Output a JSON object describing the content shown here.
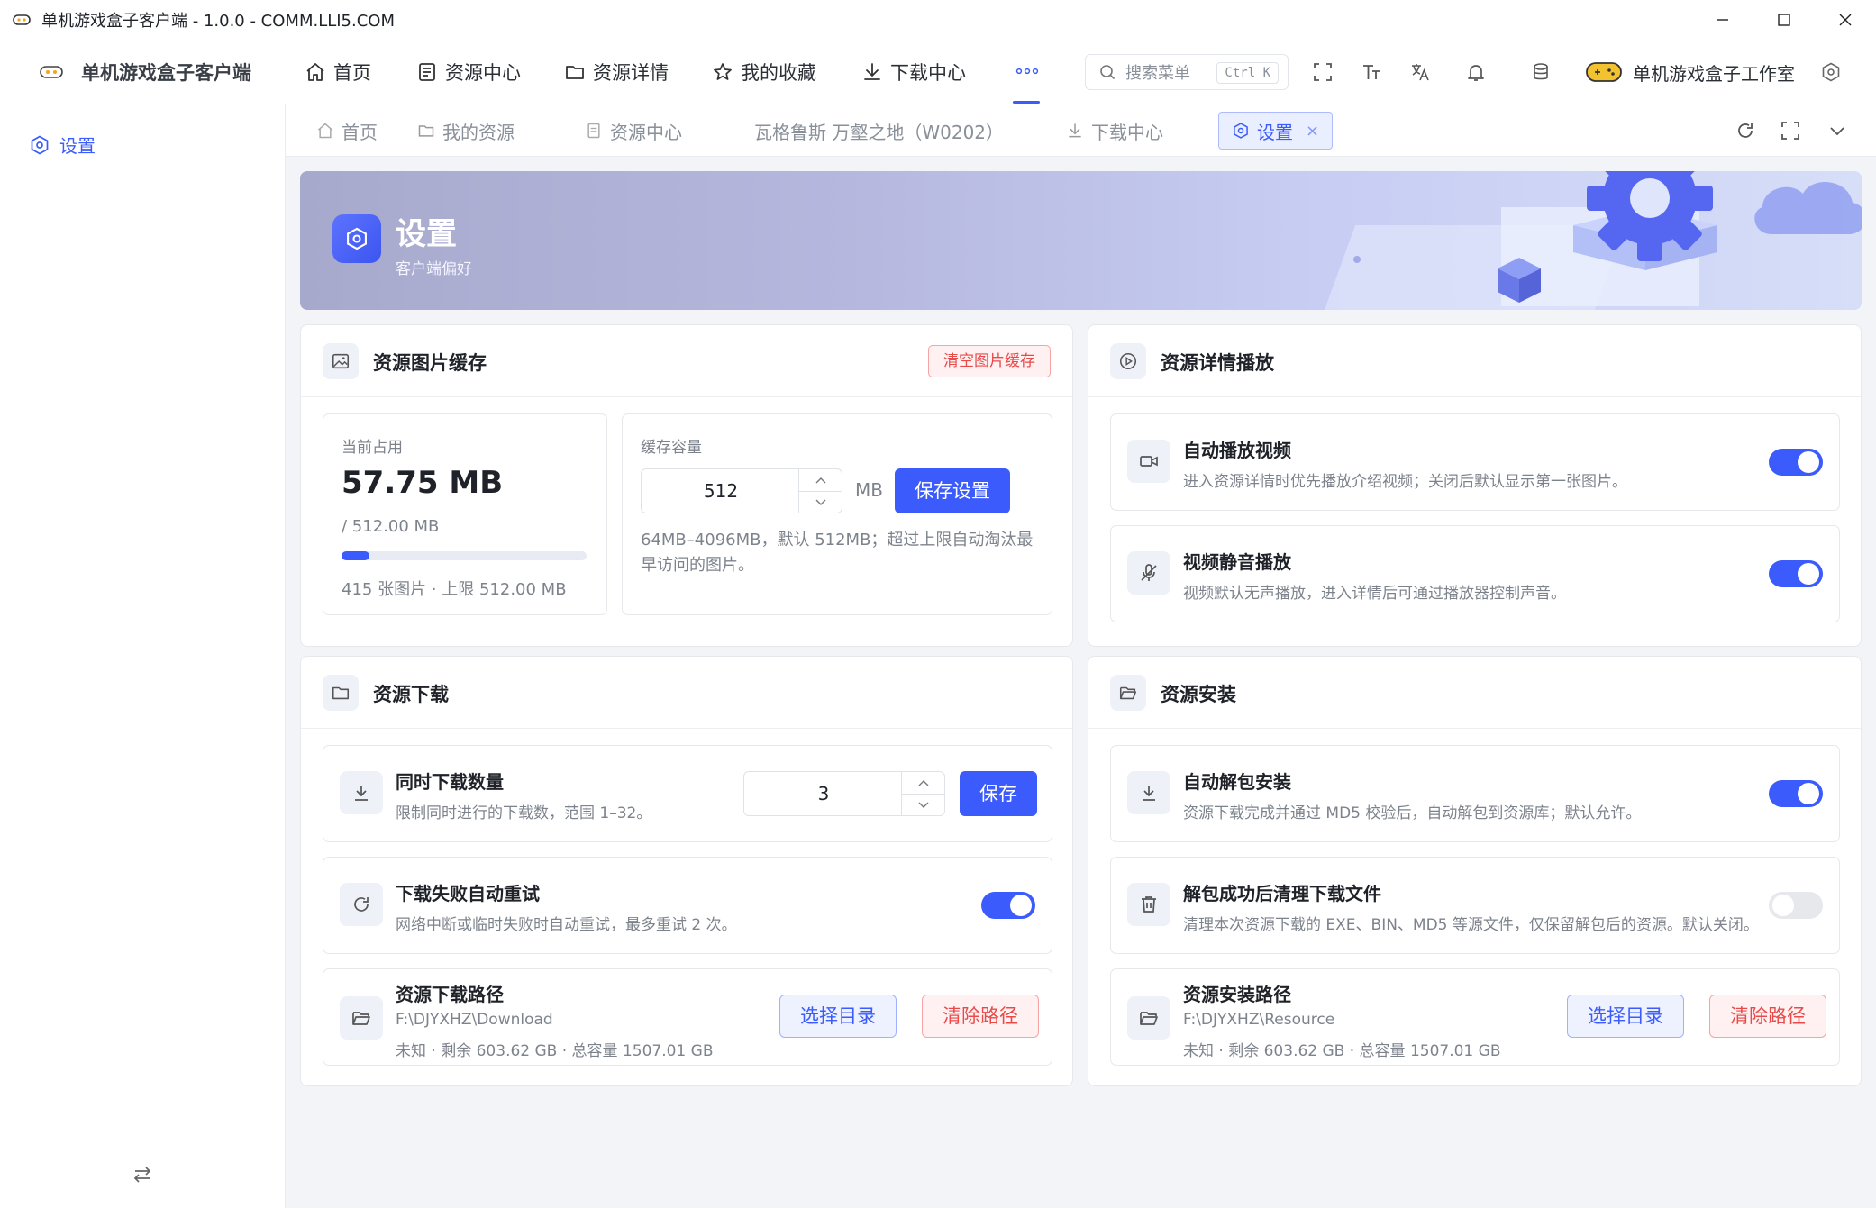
{
  "window": {
    "title": "单机游戏盒子客户端 - 1.0.0 - COMM.LLI5.COM",
    "controls": [
      "minimize-icon",
      "maximize-icon",
      "close-icon"
    ]
  },
  "topnav": {
    "brand": "单机游戏盒子客户端",
    "items": [
      {
        "label": "首页",
        "icon": "home-icon"
      },
      {
        "label": "资源中心",
        "icon": "list-icon"
      },
      {
        "label": "资源详情",
        "icon": "folder-icon"
      },
      {
        "label": "我的收藏",
        "icon": "star-icon"
      },
      {
        "label": "下载中心",
        "icon": "download-icon"
      }
    ],
    "more_icon": "more-dots-icon",
    "search": {
      "placeholder": "搜索菜单",
      "shortcut": "Ctrl K"
    },
    "studio": "单机游戏盒子工作室"
  },
  "sidebar": {
    "items": [
      {
        "label": "设置",
        "icon": "gear-icon"
      }
    ],
    "collapse_icon": "swap-arrows-icon"
  },
  "tabs": [
    {
      "label": "首页",
      "icon": "home-icon"
    },
    {
      "label": "我的资源",
      "icon": "folder-icon"
    },
    {
      "label": "资源中心",
      "icon": "document-icon"
    },
    {
      "label": "瓦格鲁斯 万壑之地（W0202）",
      "icon": ""
    },
    {
      "label": "下载中心",
      "icon": "download-icon"
    },
    {
      "label": "设置",
      "icon": "gear-icon",
      "active": true,
      "close": "×"
    }
  ],
  "banner": {
    "title": "设置",
    "subtitle": "客户端偏好"
  },
  "image_cache": {
    "title": "资源图片缓存",
    "clear_button": "清空图片缓存",
    "current_label": "当前占用",
    "current_value": "57.75 MB",
    "limit_text": "/ 512.00 MB",
    "usage_percent": 11.3,
    "footer": "415 张图片 · 上限 512.00 MB",
    "capacity_label": "缓存容量",
    "capacity_value": "512",
    "capacity_unit": "MB",
    "save_button": "保存设置",
    "hint": "64MB–4096MB，默认 512MB；超过上限自动淘汰最早访问的图片。"
  },
  "playback": {
    "title": "资源详情播放",
    "rows": [
      {
        "title": "自动播放视频",
        "desc": "进入资源详情时优先播放介绍视频；关闭后默认显示第一张图片。",
        "on": true,
        "icon": "video-camera-icon"
      },
      {
        "title": "视频静音播放",
        "desc": "视频默认无声播放，进入详情后可通过播放器控制声音。",
        "on": true,
        "icon": "mic-off-icon"
      }
    ]
  },
  "download": {
    "title": "资源下载",
    "concurrent": {
      "title": "同时下载数量",
      "desc": "限制同时进行的下载数，范围 1–32。",
      "value": "3",
      "save": "保存"
    },
    "retry": {
      "title": "下载失败自动重试",
      "desc": "网络中断或临时失败时自动重试，最多重试 2 次。",
      "on": true
    },
    "path": {
      "title": "资源下载路径",
      "path": "F:\\DJYXHZ\\Download",
      "space": "未知 · 剩余 603.62 GB · 总容量 1507.01 GB",
      "choose": "选择目录",
      "clear": "清除路径"
    }
  },
  "install": {
    "title": "资源安装",
    "auto_unpack": {
      "title": "自动解包安装",
      "desc": "资源下载完成并通过 MD5 校验后，自动解包到资源库；默认允许。",
      "on": true
    },
    "cleanup": {
      "title": "解包成功后清理下载文件",
      "desc": "清理本次资源下载的 EXE、BIN、MD5 等源文件，仅保留解包后的资源。默认关闭。",
      "on": false
    },
    "path": {
      "title": "资源安装路径",
      "path": "F:\\DJYXHZ\\Resource",
      "space": "未知 · 剩余 603.62 GB · 总容量 1507.01 GB",
      "choose": "选择目录",
      "clear": "清除路径"
    }
  },
  "colors": {
    "accent": "#3b5bfd",
    "danger": "#e84a4a",
    "muted": "#7d838c",
    "background": "#f3f4f7"
  }
}
